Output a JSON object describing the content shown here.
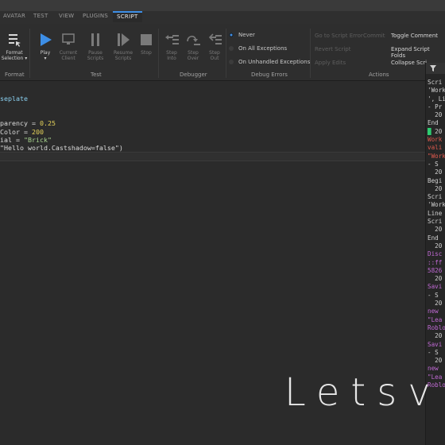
{
  "tabs": [
    "AVATAR",
    "TEST",
    "VIEW",
    "PLUGINS",
    "SCRIPT"
  ],
  "active_tab": "SCRIPT",
  "ribbon": {
    "format": {
      "label1": "Format",
      "label2": "Selection ▾",
      "group": "Format"
    },
    "play": {
      "label": "Play",
      "arrow": "▾"
    },
    "current_client": [
      "Current",
      "Client"
    ],
    "pause_scripts": [
      "Pause",
      "Scripts"
    ],
    "resume_scripts": [
      "Resume",
      "Scripts"
    ],
    "stop": "Stop",
    "step_into": [
      "Step",
      "Into"
    ],
    "step_over": [
      "Step",
      "Over"
    ],
    "step_out": [
      "Step",
      "Out"
    ],
    "groups": {
      "test": "Test",
      "debugger": "Debugger",
      "debug_errors": "Debug Errors",
      "actions": "Actions"
    },
    "debug_errors": {
      "never": "Never",
      "all": "On All Exceptions",
      "unhandled": "On Unhandled Exceptions"
    },
    "actions_disabled": [
      "Go to Script Error",
      "Commit",
      "Revert Script",
      "Apply Edits"
    ],
    "actions": [
      "Toggle Comment",
      "Expand Script Folds",
      "Collapse Scri"
    ]
  },
  "code_lines": [
    {
      "parts": [
        {
          "t": "seplate",
          "c": "cyan"
        }
      ]
    },
    {
      "parts": [
        {
          "t": "",
          "c": ""
        }
      ]
    },
    {
      "parts": [
        {
          "t": "",
          "c": ""
        }
      ]
    },
    {
      "parts": [
        {
          "t": "parency = ",
          "c": ""
        },
        {
          "t": "0.25",
          "c": "num"
        }
      ]
    },
    {
      "parts": [
        {
          "t": "Color = ",
          "c": ""
        },
        {
          "t": "200",
          "c": "num"
        }
      ]
    },
    {
      "parts": [
        {
          "t": "ial = ",
          "c": ""
        },
        {
          "t": "\"Brick\"",
          "c": "str"
        }
      ]
    },
    {
      "parts": [
        {
          "t": "\"Hello world.Castshadow=false\")",
          "c": ""
        }
      ]
    }
  ],
  "output_lines": [
    {
      "t": "Scri",
      "c": "o-n"
    },
    {
      "t": "'Work",
      "c": "o-n"
    },
    {
      "t": "', Li",
      "c": "o-n"
    },
    {
      "t": "- Pr",
      "c": "o-n"
    },
    {
      "t": "  20",
      "c": "o-n"
    },
    {
      "t": "End ",
      "c": "o-n"
    },
    {
      "t": "█ 20",
      "c": "o-n"
    },
    {
      "t": "Work",
      "c": "o-r"
    },
    {
      "t": "vali",
      "c": "o-r"
    },
    {
      "t": "\"Work",
      "c": "o-r"
    },
    {
      "t": "- S",
      "c": "o-n"
    },
    {
      "t": "  20",
      "c": "o-n"
    },
    {
      "t": "Begi",
      "c": "o-n"
    },
    {
      "t": "  20",
      "c": "o-n"
    },
    {
      "t": "Scri",
      "c": "o-n"
    },
    {
      "t": "'Work",
      "c": "o-n"
    },
    {
      "t": "Line ",
      "c": "o-n"
    },
    {
      "t": "Scri",
      "c": "o-n"
    },
    {
      "t": "  20",
      "c": "o-n"
    },
    {
      "t": "End ",
      "c": "o-n"
    },
    {
      "t": "  20",
      "c": "o-n"
    },
    {
      "t": "Disc",
      "c": "o-p"
    },
    {
      "t": "::ff",
      "c": "o-p"
    },
    {
      "t": "5826",
      "c": "o-p"
    },
    {
      "t": "  20",
      "c": "o-n"
    },
    {
      "t": "Savi",
      "c": "o-p"
    },
    {
      "t": "- S",
      "c": "o-n"
    },
    {
      "t": "  20",
      "c": "o-n"
    },
    {
      "t": "new ",
      "c": "o-p"
    },
    {
      "t": "\"Lea",
      "c": "o-p"
    },
    {
      "t": "Roblo",
      "c": "o-p"
    },
    {
      "t": "  20",
      "c": "o-n"
    },
    {
      "t": "Savi",
      "c": "o-p"
    },
    {
      "t": "- S",
      "c": "o-n"
    },
    {
      "t": "  20",
      "c": "o-n"
    },
    {
      "t": "new ",
      "c": "o-p"
    },
    {
      "t": "\"Lea",
      "c": "o-p"
    },
    {
      "t": "Roblo",
      "c": "o-p"
    }
  ],
  "watermark": "Letsv"
}
